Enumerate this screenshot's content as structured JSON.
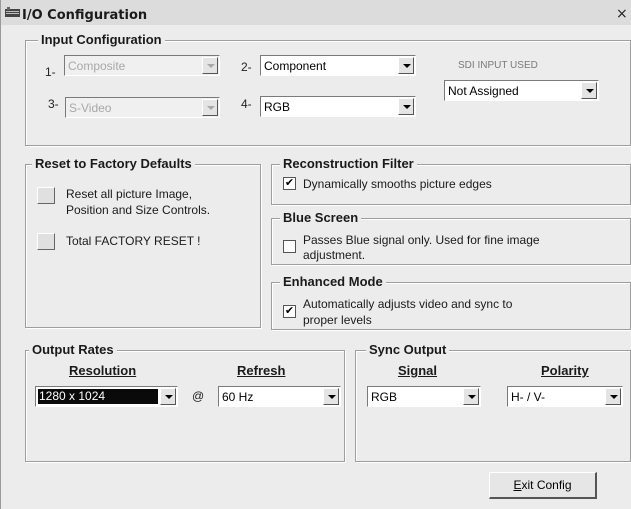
{
  "window": {
    "title": "I/O Configuration",
    "close": "×"
  },
  "input_config": {
    "legend": "Input Configuration",
    "slot1": {
      "num": "1-",
      "value": "Composite"
    },
    "slot2": {
      "num": "2-",
      "value": "Component"
    },
    "slot3": {
      "num": "3-",
      "value": "S-Video"
    },
    "slot4": {
      "num": "4-",
      "value": "RGB"
    },
    "sdi_label": "SDI INPUT USED",
    "sdi_value": "Not Assigned"
  },
  "reset": {
    "legend": "Reset to Factory Defaults",
    "btn1_line1": "Reset all picture Image,",
    "btn1_line2": "Position and Size Controls.",
    "btn2_label": "Total FACTORY RESET !"
  },
  "recon": {
    "legend": "Reconstruction Filter",
    "text": "Dynamically smooths picture edges",
    "checked": "✔"
  },
  "blue": {
    "legend": "Blue Screen",
    "line1": "Passes Blue signal only. Used for fine image",
    "line2": "adjustment.",
    "checked": ""
  },
  "enhanced": {
    "legend": "Enhanced Mode",
    "line1": "Automatically adjusts video and sync to",
    "line2": "proper levels",
    "checked": "✔"
  },
  "output": {
    "legend": "Output Rates",
    "res_head": "Resolution",
    "refresh_head": "Refresh",
    "res_value": "1280 x 1024",
    "at": "@",
    "refresh_value": "60 Hz"
  },
  "sync": {
    "legend": "Sync Output",
    "signal_head": "Signal",
    "polarity_head": "Polarity",
    "signal_value": "RGB",
    "polarity_value": "H- / V-"
  },
  "exit": {
    "accel": "E",
    "rest": "xit Config"
  }
}
